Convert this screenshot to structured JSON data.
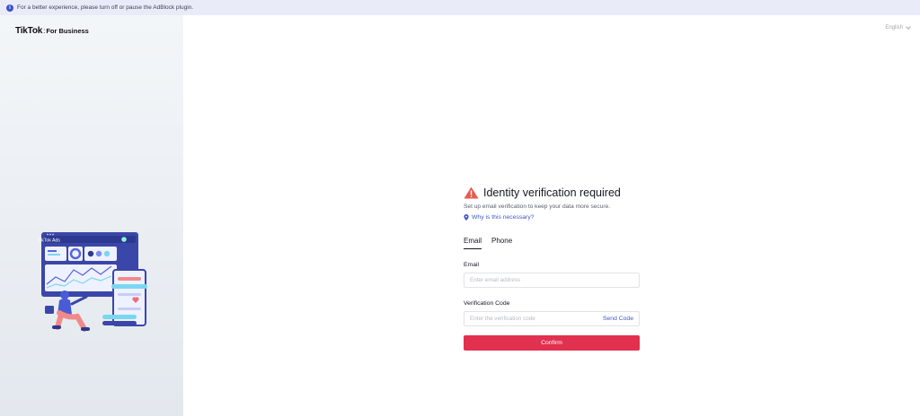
{
  "notice": {
    "text": "For a better experience, please turn off or pause the AdBlock plugin."
  },
  "brand": {
    "name": "TikTok",
    "separator": ":",
    "suffix": "For Business"
  },
  "illustration": {
    "label": "TikTok Ads"
  },
  "language": {
    "selected": "English"
  },
  "form": {
    "title": "Identity verification required",
    "subtitle": "Set up email verification to keep your data more secure.",
    "why_link": "Why is this necessary?",
    "tabs": [
      {
        "label": "Email",
        "active": true
      },
      {
        "label": "Phone",
        "active": false
      }
    ],
    "email_label": "Email",
    "email_placeholder": "Enter email address",
    "email_value": "",
    "code_label": "Verification Code",
    "code_placeholder": "Enter the verification code",
    "code_value": "",
    "send_code": "Send Code",
    "confirm": "Confirm"
  },
  "colors": {
    "accent": "#e1314f",
    "link": "#3f56c9",
    "warning": "#e85a4f",
    "notice_bg": "#e9ecf8"
  }
}
